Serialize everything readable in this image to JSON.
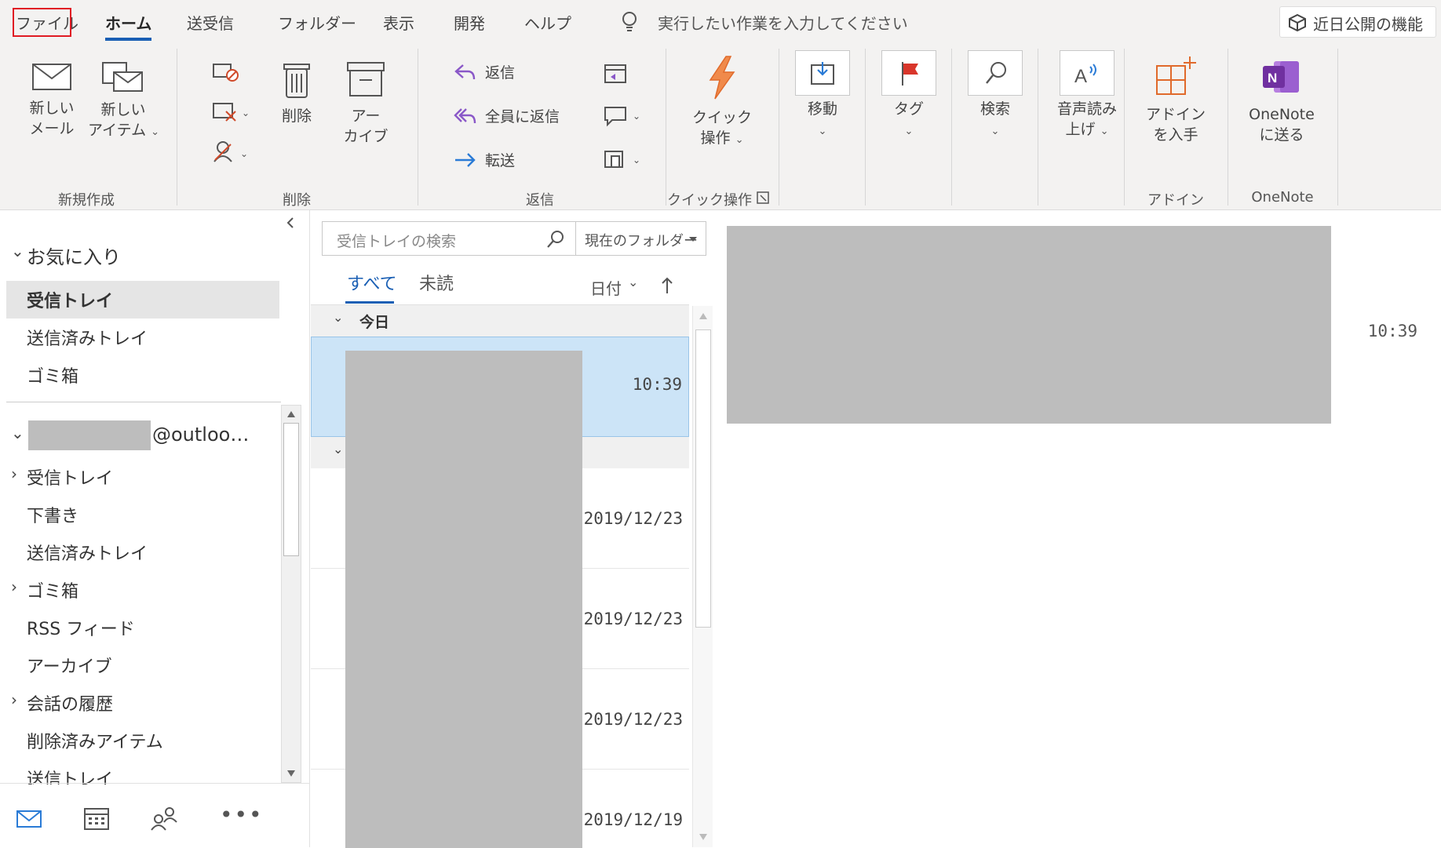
{
  "menubar": {
    "tabs": [
      "ファイル",
      "ホーム",
      "送受信",
      "フォルダー",
      "表示",
      "開発",
      "ヘルプ"
    ],
    "tell_me": "実行したい作業を入力してください",
    "coming_soon": "近日公開の機能"
  },
  "ribbon": {
    "new_mail": "新しい\nメール",
    "new_item": "新しい\nアイテム",
    "delete": "削除",
    "archive": "アー\nカイブ",
    "reply": "返信",
    "reply_all": "全員に返信",
    "forward": "転送",
    "quick_steps": "クイック\n操作",
    "move": "移動",
    "tags": "タグ",
    "search": "検索",
    "read_aloud": "音声読み\n上げ",
    "get_addins": "アドイン\nを入手",
    "send_onenote": "OneNote\nに送る",
    "groups": {
      "new": "新規作成",
      "delete": "削除",
      "respond": "返信",
      "quick_steps": "クイック操作",
      "addin": "アドイン",
      "onenote": "OneNote"
    }
  },
  "nav": {
    "favorites": "お気に入り",
    "fav_items": [
      "受信トレイ",
      "送信済みトレイ",
      "ゴミ箱"
    ],
    "account_suffix": "@outloo…",
    "account_items": [
      "受信トレイ",
      "下書き",
      "送信済みトレイ",
      "ゴミ箱",
      "RSS フィード",
      "アーカイブ",
      "会話の履歴",
      "削除済みアイテム",
      "送信トレイ"
    ]
  },
  "list": {
    "search_placeholder": "受信トレイの検索",
    "scope": "現在のフォルダー",
    "filter_all": "すべて",
    "filter_unread": "未読",
    "sort": "日付",
    "group_today": "今日",
    "times": [
      "10:39",
      "2019/12/23",
      "2019/12/23",
      "2019/12/23",
      "2019/12/19"
    ]
  },
  "reading": {
    "time": "10:39"
  }
}
